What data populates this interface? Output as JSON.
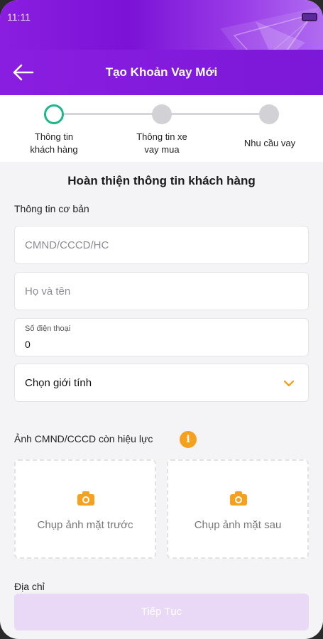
{
  "statusbar": {
    "time": "11:11"
  },
  "header": {
    "title": "Tạo Khoản Vay Mới",
    "back_icon": "arrow-left-icon"
  },
  "stepper": {
    "steps": [
      {
        "label_line1": "Thông tin",
        "label_line2": "khách hàng",
        "state": "active"
      },
      {
        "label_line1": "Thông tin xe",
        "label_line2": "vay mua",
        "state": "inactive"
      },
      {
        "label_line1": "Nhu cầu vay",
        "label_line2": "",
        "state": "inactive"
      }
    ],
    "active_color": "#1fb68a",
    "inactive_color": "#d2d2d6"
  },
  "main": {
    "title": "Hoàn thiện thông tin khách hàng",
    "basic_info_label": "Thông tin cơ bản",
    "id_placeholder": "CMND/CCCD/HC",
    "name_placeholder": "Họ và tên",
    "phone_label": "Số điện thoại",
    "phone_value": "0",
    "gender_select": "Chọn giới tính",
    "id_photo_label": "Ảnh CMND/CCCD còn hiệu lực",
    "front_photo_label": "Chụp ảnh mặt trước",
    "back_photo_label": "Chụp ảnh mặt sau",
    "address_label": "Địa chỉ",
    "continue_label": "Tiếp Tục"
  },
  "colors": {
    "brand_purple": "#7c18d8",
    "accent_orange": "#f5a120",
    "disabled_button": "#e9d8f6"
  }
}
